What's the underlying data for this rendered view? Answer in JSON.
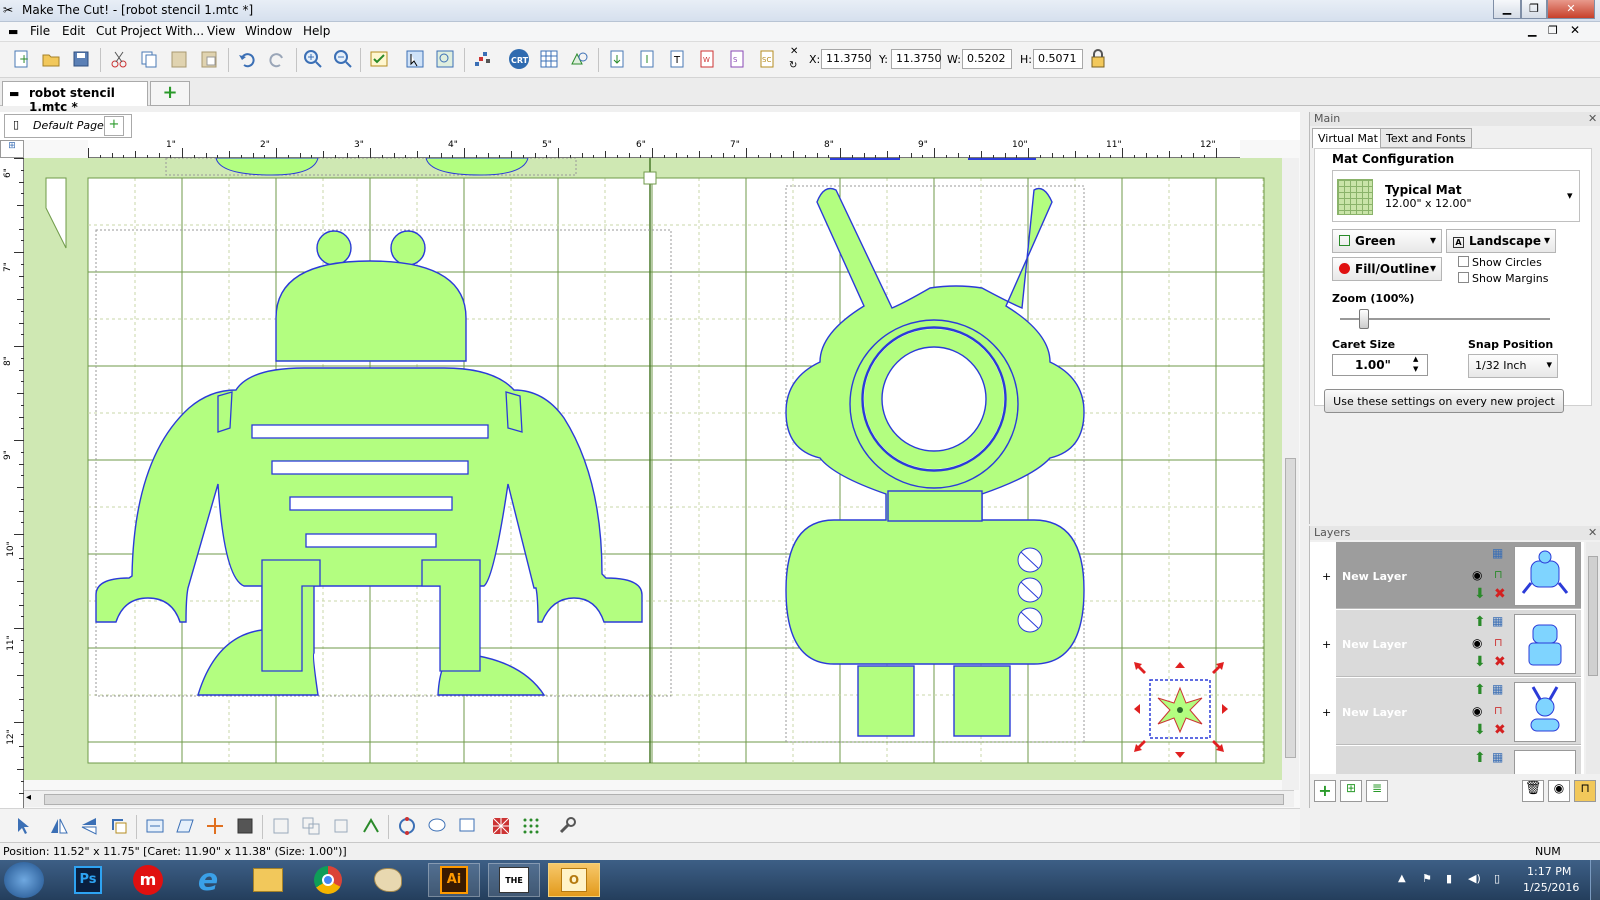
{
  "window": {
    "title": "Make The Cut! - [robot stencil 1.mtc *]",
    "min": "▁",
    "max": "❐",
    "close": "✕"
  },
  "menu": [
    "File",
    "Edit",
    "Cut Project With...",
    "View",
    "Window",
    "Help"
  ],
  "coords": {
    "x_label": "X:",
    "x": "11.3750",
    "y_label": "Y:",
    "y": "11.3750",
    "w_label": "W:",
    "w": "0.5202",
    "h_label": "H:",
    "h": "0.5071"
  },
  "doc_tab": "robot stencil 1.mtc *",
  "page_tab": "Default Page",
  "ruler": {
    "top": [
      "1\"",
      "2\"",
      "3\"",
      "4\"",
      "5\"",
      "6\"",
      "7\"",
      "8\"",
      "9\"",
      "10\"",
      "11\"",
      "12\""
    ],
    "left": [
      "6\"",
      "7\"",
      "8\"",
      "9\"",
      "10\"",
      "11\"",
      "12\""
    ]
  },
  "panel": {
    "header": "Main",
    "tabs": [
      "Virtual Mat",
      "Text and Fonts"
    ],
    "mat_config_label": "Mat Configuration",
    "mat_name": "Typical Mat",
    "mat_size": "12.00\" x 12.00\"",
    "color_select": "Green",
    "orientation_select": "Landscape",
    "view_select": "Fill/Outline",
    "show_circles": "Show Circles",
    "show_margins": "Show Margins",
    "zoom_label": "Zoom (100%)",
    "zoom_level": 0.1,
    "caret_label": "Caret Size",
    "caret_value": "1.00\"",
    "snap_label": "Snap Position",
    "snap_value": "1/32 Inch",
    "settings_button": "Use these settings on every new project"
  },
  "layers": {
    "header": "Layers",
    "items": [
      {
        "name": "New Layer"
      },
      {
        "name": "New Layer"
      },
      {
        "name": "New Layer"
      }
    ]
  },
  "status": {
    "position": "Position: 11.52\" x 11.75\" [Caret: 11.90\" x 11.38\" (Size: 1.00\")]",
    "num": "NUM"
  },
  "taskbar": {
    "time": "1:17 PM",
    "date": "1/25/2016"
  },
  "colors": {
    "shape_fill": "#b3fe80",
    "shape_stroke": "#2b3bd8",
    "mat": "#cfe8b3",
    "grid": "#6f9a48"
  }
}
